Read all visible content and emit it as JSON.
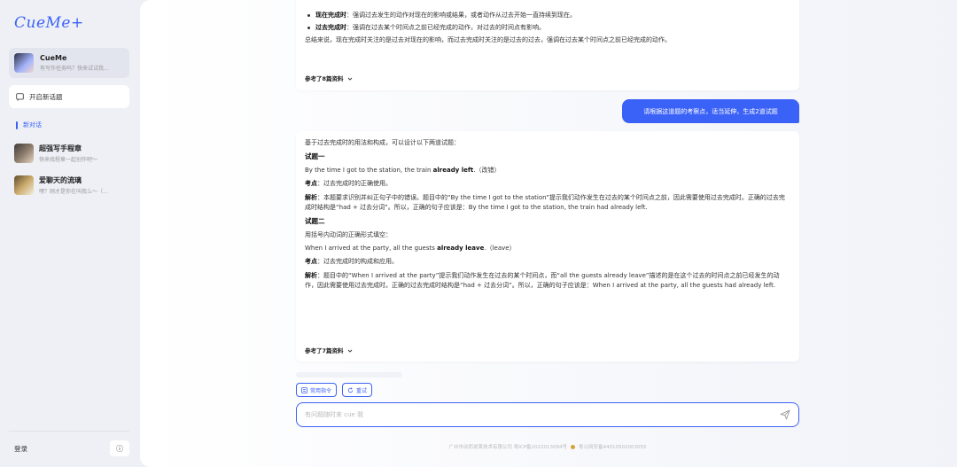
{
  "app": {
    "logo": "CueMe+"
  },
  "sidebar": {
    "agent": {
      "title": "CueMe",
      "subtitle": "有写作任务吗？快来试试我..."
    },
    "new_topic": "开启新话题",
    "new_chat": "新对话",
    "history": [
      {
        "title": "超强写手程章",
        "subtitle": "快来找程章一起创作吧～"
      },
      {
        "title": "爱聊天的流璃",
        "subtitle": "嘿？刚才是你在叫我么～（..."
      }
    ],
    "login": "登录",
    "info_icon": "ⓘ"
  },
  "msg1": {
    "b1_label": "现在完成时",
    "b1_text": "：强调过去发生的动作对现在的影响或结果，或者动作从过去开始一直持续到现在。",
    "b2_label": "过去完成时",
    "b2_text": "：强调在过去某个时间点之前已经完成的动作，对过去的时间点有影响。",
    "summary": "总结来说，现在完成时关注的是过去对现在的影响，而过去完成时关注的是过去的过去，强调在过去某个时间点之前已经完成的动作。",
    "ref": "参考了8篇资料"
  },
  "user_msg": "请根据这道题的考察点，适当延伸，生成2道试题",
  "msg2": {
    "intro": "基于过去完成时的用法和构成，可以设计以下两道试题：",
    "q1_title": "试题一",
    "q1_pre": "By the time I got to the station, the train ",
    "q1_bold": "already left",
    "q1_post": ".（改错）",
    "q1_point_label": "考点",
    "q1_point": "：过去完成时的正确使用。",
    "q1_ana_label": "解析",
    "q1_ana": "：本题要求识别并纠正句子中的错误。题目中的“By the time I got to the station”提示我们动作发生在过去的某个时间点之前，因此需要使用过去完成时。正确的过去完成时结构是“had + 过去分词”。所以，正确的句子应该是：By the time I got to the station, the train had already left.",
    "q2_title": "试题二",
    "q2_instr": "用括号内动词的正确形式填空：",
    "q2_pre": "When I arrived at the party, all the guests ",
    "q2_bold": "already leave",
    "q2_post": ".（leave）",
    "q2_point_label": "考点",
    "q2_point": "：过去完成时的构成和应用。",
    "q2_ana_label": "解析",
    "q2_ana": "：题目中的“When I arrived at the party”提示我们动作发生在过去的某个时间点，而“all the guests already leave”描述的是在这个过去的时间点之前已经发生的动作，因此需要使用过去完成时。正确的过去完成时结构是“had + 过去分词”。所以，正确的句子应该是：When I arrived at the party, all the guests had already left.",
    "ref": "参考了7篇资料"
  },
  "actions": {
    "common_cmd": "常用指令",
    "retry": "重试"
  },
  "input": {
    "placeholder": "有问题随时来 cue 我"
  },
  "footer": {
    "icp": "广州市动而说莱技术有限公司 粤ICP备2022013084号",
    "police": "粤公网安备44010502003055"
  },
  "colors": {
    "accent": "#3b62f6"
  }
}
